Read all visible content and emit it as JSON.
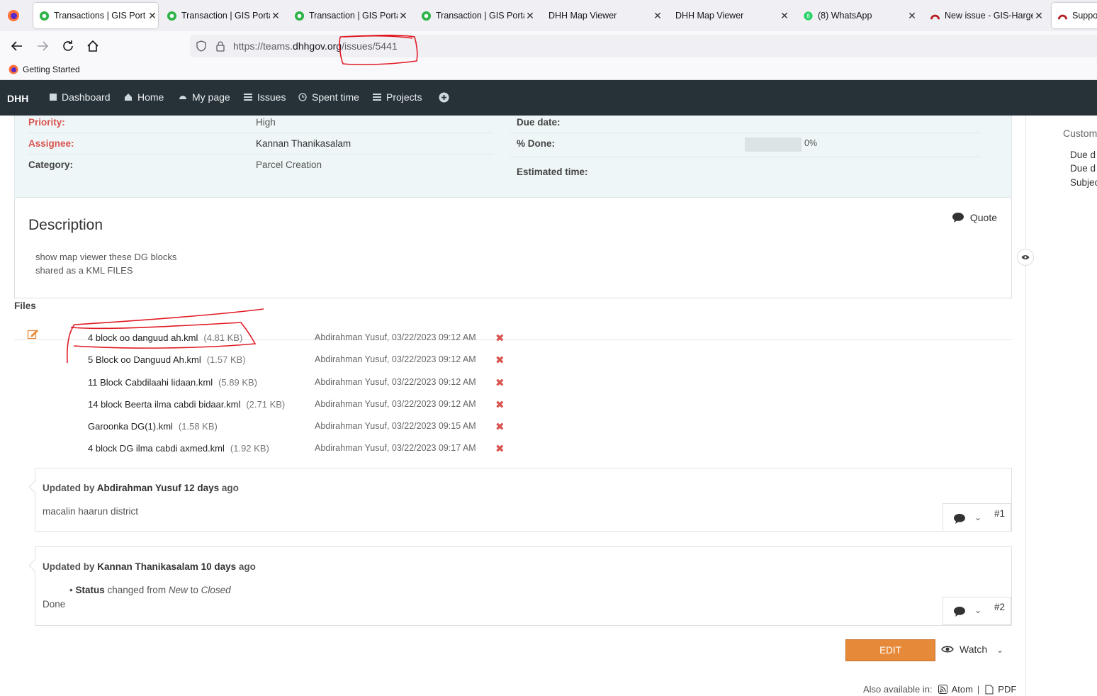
{
  "browser": {
    "tabs": [
      {
        "title": "Transactions | GIS Port",
        "favicon": "gis-portal-icon",
        "active": true
      },
      {
        "title": "Transaction | GIS Portal",
        "favicon": "gis-portal-icon"
      },
      {
        "title": "Transaction | GIS Portal",
        "favicon": "gis-portal-icon"
      },
      {
        "title": "Transaction | GIS Portal",
        "favicon": "gis-portal-icon"
      },
      {
        "title": "DHH Map Viewer",
        "favicon": ""
      },
      {
        "title": "DHH Map Viewer",
        "favicon": ""
      },
      {
        "title": "(8) WhatsApp",
        "favicon": "whatsapp-icon"
      },
      {
        "title": "New issue - GIS-Hargeisa",
        "favicon": "redmine-icon"
      },
      {
        "title": "Suppo",
        "favicon": "redmine-icon"
      }
    ],
    "url": {
      "prefix": "https://teams.",
      "domain": "dhhgov.org",
      "path": "/issues/5441"
    },
    "bookmark": "Getting Started"
  },
  "topmenu": {
    "brand": "DHH",
    "items": [
      "Dashboard",
      "Home",
      "My page",
      "Issues",
      "Spent time",
      "Projects"
    ]
  },
  "attributes": {
    "priority_label": "Priority:",
    "priority": "High",
    "assignee_label": "Assignee:",
    "assignee": "Kannan Thanikasalam",
    "category_label": "Category:",
    "category": "Parcel Creation",
    "due_label": "Due date:",
    "due": "",
    "done_label": "% Done:",
    "done": "0%",
    "done_fraction": 0,
    "estimated_label": "Estimated time:",
    "estimated": ""
  },
  "description": {
    "title": "Description",
    "quote": "Quote",
    "lines": [
      "show map viewer these DG blocks",
      "shared as a KML FILES"
    ]
  },
  "files": {
    "label": "Files",
    "items": [
      {
        "name": "4 block oo danguud ah.kml",
        "size": "(4.81 KB)",
        "meta": "Abdirahman Yusuf, 03/22/2023 09:12 AM"
      },
      {
        "name": "5 Block oo Danguud Ah.kml",
        "size": "(1.57 KB)",
        "meta": "Abdirahman Yusuf, 03/22/2023 09:12 AM"
      },
      {
        "name": "11 Block Cabdilaahi lidaan.kml",
        "size": "(5.89 KB)",
        "meta": "Abdirahman Yusuf, 03/22/2023 09:12 AM"
      },
      {
        "name": "14 block Beerta ilma cabdi bidaar.kml",
        "size": "(2.71 KB)",
        "meta": "Abdirahman Yusuf, 03/22/2023 09:12 AM"
      },
      {
        "name": "Garoonka DG(1).kml",
        "size": "(1.58 KB)",
        "meta": "Abdirahman Yusuf, 03/22/2023 09:15 AM"
      },
      {
        "name": "4 block DG ilma cabdi axmed.kml",
        "size": "(1.92 KB)",
        "meta": "Abdirahman Yusuf, 03/22/2023 09:17 AM"
      }
    ]
  },
  "journals": [
    {
      "prefix": "Updated by",
      "author": "Abdirahman Yusuf",
      "age": "12 days",
      "suffix": "ago",
      "note": "macalin haarun district",
      "number": "#1"
    },
    {
      "prefix": "Updated by",
      "author": "Kannan Thanikasalam",
      "age": "10 days",
      "suffix": "ago",
      "detail_field": "Status",
      "detail_mid": "changed from",
      "detail_old": "New",
      "detail_to": "to",
      "detail_new": "Closed",
      "note": "Done",
      "number": "#2"
    }
  ],
  "actions": {
    "edit": "EDIT",
    "watch": "Watch"
  },
  "also": {
    "label": "Also available in:",
    "atom": "Atom",
    "sep": "|",
    "pdf": "PDF"
  },
  "sidebar": {
    "title": "Custom",
    "items": [
      "Due d",
      "Due d",
      "Subjec"
    ]
  },
  "colors": {
    "topmenu": "#263238",
    "label_red": "#d9534f",
    "edit_button": "#e68a3a",
    "annotation": "#e01b24"
  }
}
